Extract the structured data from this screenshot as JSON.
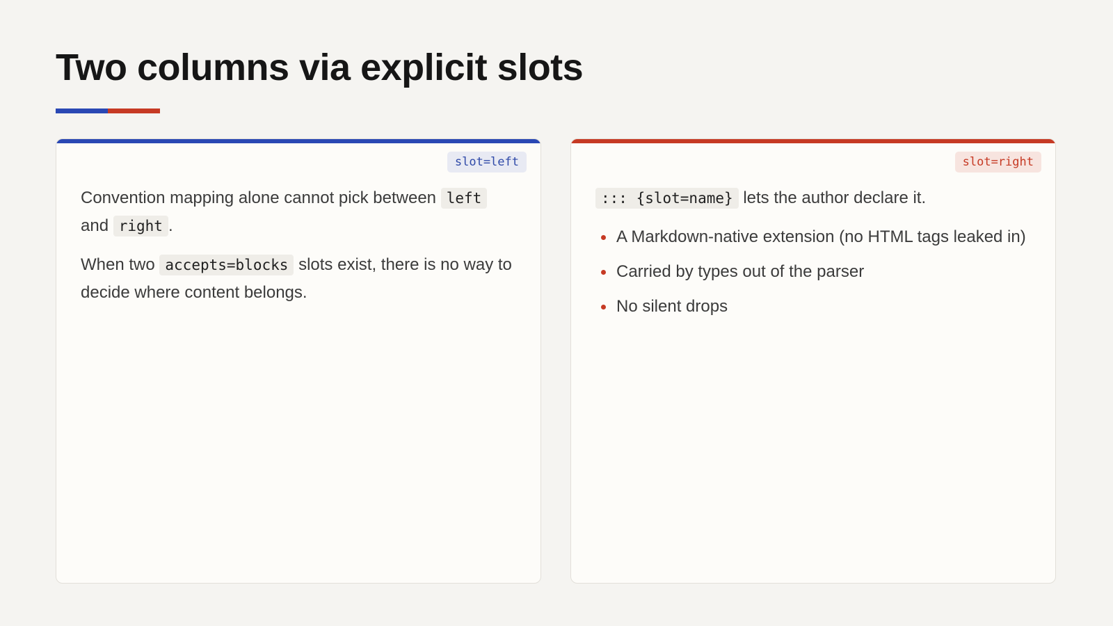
{
  "title": "Two columns via explicit slots",
  "colors": {
    "accent_blue": "#2a48b4",
    "accent_red": "#c63a24",
    "background": "#f5f4f1",
    "panel_background": "#fdfcf9"
  },
  "left_panel": {
    "badge": "slot=left",
    "paragraph1": {
      "text_a": "Convention mapping alone cannot pick between ",
      "code_a": "left",
      "text_b": " and ",
      "code_b": "right",
      "text_c": "."
    },
    "paragraph2": {
      "text_a": "When two ",
      "code_a": "accepts=blocks",
      "text_b": " slots exist, there is no way to decide where content belongs."
    }
  },
  "right_panel": {
    "badge": "slot=right",
    "intro": {
      "code": "::: {slot=name}",
      "text": " lets the author declare it."
    },
    "bullets": [
      "A Markdown-native extension (no HTML tags leaked in)",
      "Carried by types out of the parser",
      "No silent drops"
    ]
  }
}
